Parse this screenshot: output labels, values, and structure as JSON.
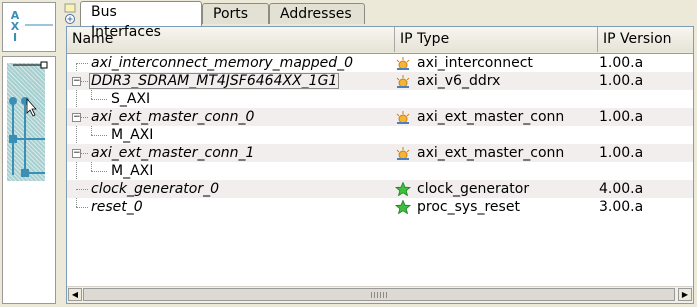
{
  "left_panel": {
    "bus_label": "AXI"
  },
  "tabs": [
    {
      "label": "Bus Interfaces",
      "active": true
    },
    {
      "label": "Ports",
      "active": false
    },
    {
      "label": "Addresses",
      "active": false
    }
  ],
  "columns": [
    "Name",
    "IP Type",
    "IP Version"
  ],
  "rows": [
    {
      "name": "axi_interconnect_memory_mapped_0",
      "ip_type": "axi_interconnect",
      "ip_version": "1.00.a",
      "icon": "hub-icon"
    },
    {
      "name": "DDR3_SDRAM_MT4JSF6464XX_1G1",
      "ip_type": "axi_v6_ddrx",
      "ip_version": "1.00.a",
      "icon": "hub-icon"
    },
    {
      "name": "S_AXI",
      "ip_type": "",
      "ip_version": ""
    },
    {
      "name": "axi_ext_master_conn_0",
      "ip_type": "axi_ext_master_conn",
      "ip_version": "1.00.a",
      "icon": "hub-icon"
    },
    {
      "name": "M_AXI",
      "ip_type": "",
      "ip_version": ""
    },
    {
      "name": "axi_ext_master_conn_1",
      "ip_type": "axi_ext_master_conn",
      "ip_version": "1.00.a",
      "icon": "hub-icon"
    },
    {
      "name": "M_AXI",
      "ip_type": "",
      "ip_version": ""
    },
    {
      "name": "clock_generator_0",
      "ip_type": "clock_generator",
      "ip_version": "4.00.a",
      "icon": "star-icon"
    },
    {
      "name": "reset_0",
      "ip_type": "proc_sys_reset",
      "ip_version": "3.00.a",
      "icon": "star-icon"
    }
  ],
  "colors": {
    "star": "#2fae2f",
    "hub": "#e8941a",
    "bus": "#3a8fb7"
  }
}
